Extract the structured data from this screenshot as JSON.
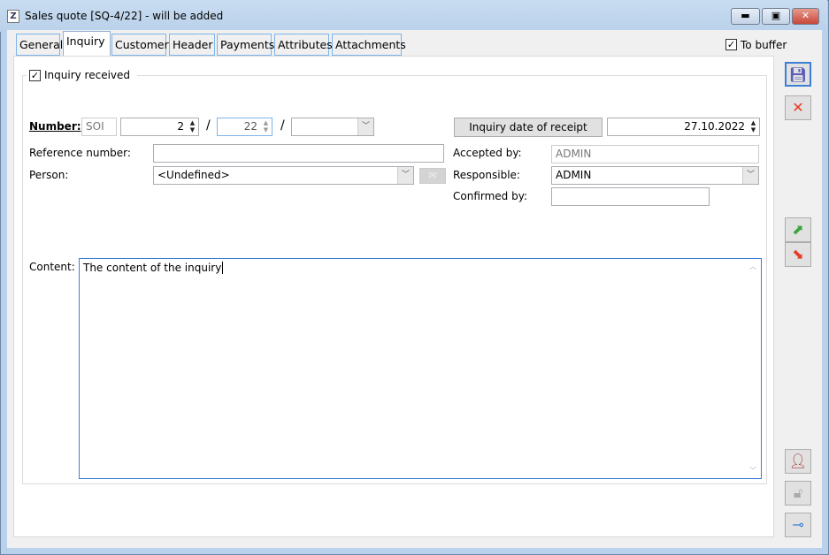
{
  "window": {
    "title": "Sales quote [SQ-4/22] - will be added",
    "app_icon": "Z",
    "controls": {
      "minimize": "minimize-icon",
      "maximize": "maximize-icon",
      "close": "close-icon",
      "close_color": "#c9483a"
    }
  },
  "tabs": [
    {
      "label": "General"
    },
    {
      "label": "Inquiry",
      "active": true
    },
    {
      "label": "Customer"
    },
    {
      "label": "Header"
    },
    {
      "label": "Payments"
    },
    {
      "label": "Attributes"
    },
    {
      "label": "Attachments"
    }
  ],
  "to_buffer": {
    "label": "To buffer",
    "checked": true
  },
  "inquiry": {
    "received_label": "Inquiry received",
    "received_checked": true,
    "number_label": "Number:",
    "number_prefix": "SOI",
    "number_value": "2",
    "number_year": "22",
    "number_sep": "/",
    "number_series": "",
    "reference_label": "Reference number:",
    "reference_value": "",
    "person_label": "Person:",
    "person_value": "<Undefined>",
    "date_button": "Inquiry date of receipt",
    "date_value": "27.10.2022",
    "accepted_label": "Accepted by:",
    "accepted_value": "ADMIN",
    "responsible_label": "Responsible:",
    "responsible_value": "ADMIN",
    "confirmed_label": "Confirmed by:",
    "confirmed_value": "",
    "content_label": "Content:",
    "content_value": "The content of the inquiry"
  },
  "toolbar": [
    "save-icon",
    "cancel-icon",
    "export-icon",
    "import-icon",
    "user-icon",
    "lock-icon",
    "pin-icon"
  ],
  "colors": {
    "accent": "#3c7fd6",
    "tab_border": "#7eb4ea",
    "titlebar": "#b9d1ea"
  }
}
